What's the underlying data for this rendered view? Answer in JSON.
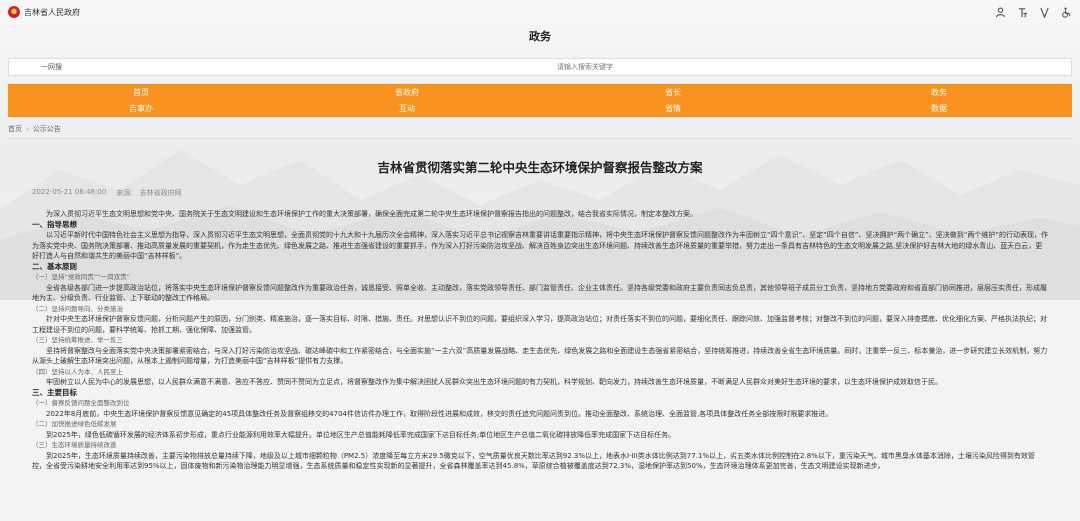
{
  "header": {
    "site_name": "吉林省人民政府"
  },
  "tools": [
    {
      "name": "person-icon"
    },
    {
      "name": "font-size-icon"
    },
    {
      "name": "accessibility-icon"
    },
    {
      "name": "wheelchair-icon"
    }
  ],
  "section": {
    "title": "政务"
  },
  "search": {
    "scope": "一网搜",
    "placeholder": "请输入搜索关键字"
  },
  "nav": {
    "items": [
      "首页",
      "省政府",
      "省长",
      "政务",
      "吉事办",
      "互动",
      "省情",
      "数据"
    ]
  },
  "breadcrumb": {
    "home": "首页",
    "current": "公示公告"
  },
  "article": {
    "title": "吉林省贯彻落实第二轮中央生态环境保护督察报告整改方案",
    "date": "2022-05-21 06:46:00",
    "source": "来源： 吉林省政府网",
    "intro": "为深入贯彻习近平生态文明思想和党中央、国务院关于生态文明建设和生态环境保护工作的重大决策部署，确保全面完成第二轮中央生态环境保护督察报告指出的问题整改，结合我省实际情况，制定本整改方案。",
    "s1_title": "一、指导思想",
    "s1_text": "以习近平新时代中国特色社会主义思想为指导，深入贯彻习近平生态文明思想，全面贯彻党的十九大和十九届历次全会精神，深入落实习近平总书记视察吉林重要讲话重要指示精神，将中央生态环境保护督察反馈问题整改作为丰固树立“四个意识”、坚定“四个自信”、坚决拥护“两个确立”、坚决做到“两个维护”的行动表现，作为落实党中央、国务院决策部署、推动高质量发展的重要契机，作为走生态优先、绿色发展之路、推进生态强省建设的重要抓手，作为深入打好污染防治攻坚战、解决百姓身边突出生态环境问题、持续改善生态环境质量的重要举措，努力走出一条具有吉林特色的生态文明发展之路,坚决保护好吉林大地的绿水青山、蓝天白云，更好打造人与自然和谐共生的美丽中国“吉林样板”。",
    "s2_title": "二、基本原则",
    "p1_title": "（一）坚持“党政同责”“一岗双责”",
    "p1_text": "全省各级各部门进一步提高政治站位，将落实中央生态环境保护督察反馈问题整改作为重要政治任务，诚恳接受、照单全收、主动整改，落实党政领导责任、部门监管责任、企业主体责任。坚持各级党委和政府主要负责同志负总责，其他领导班子成员分工负责，坚持地方党委政府和省直部门协同推进，层层压实责任，形成履地为主、分级负责、行业监管、上下联动的整改工作格局。",
    "p2_title": "（二）坚持问题导向、分类施治",
    "p2_text": "针对中央生态环境保护督察反馈问题，分析问题产生的原因，分门别类、精准施治，逐一落实目标、时限、措施、责任。对思想认识不到位的问题，要组织深入学习，提高政治站位；对责任落实不到位的问题，要细化责任、跟踪问效、加强监督考核；对整改不到位的问题，要深入排查摸底、优化细化方案、严格执法执纪；对工程建设不到位的问题，要科学统筹、抢抓工期、强化保障、加强监管。",
    "p3_title": "（三）坚持统筹推进、举一反三",
    "p3_text": "坚持将督察整改与全面落实党中央决策部署紧密结合，与深入打好污染防治攻坚战、碳达峰碳中和工作紧密结合，与全面实施“一主六双”高质量发展战略、走生态优先、绿色发展之路和全面建设生态强省紧密结合，坚持统筹推进，持续改善全省生态环境质量。同时，注重举一反三、标本兼治，进一步研究建立长效机制，努力从源头上破解生态环境突出问题，从根本上遏制问题增量，为打造美丽中国“吉林样板”提供有力支撑。",
    "p4_title": "（四）坚持以人为本、人民至上",
    "p4_text": "牢固树立以人民为中心的发展思想，以人民群众满意不满意、答应不答应、赞同不赞同为立足点，将督察整改作为集中解决困扰人民群众突出生态环境问题的有力契机，科学规划、靶向发力，持续改善生态环境质量，不断满足人民群众对美好生态环境的要求，以生态环境保护成效取信于民。",
    "s3_title": "三、主要目标",
    "g1_title": "（一）督察反馈问题全面整改到位",
    "g1_text": "2022年8月底前，中央生态环境保护督察反馈意见确定的45项具体整改任务及督察组移交的4704件信访件办理工作，取得阶段性进展和成效，移交的责任追究问题问责到位。推动全面整改、系统治理、全面监管,各项具体整改任务全部按限时限要求推进。",
    "g2_title": "（二）加快推进绿色低碳发展",
    "g2_text": "到2025年，绿色低碳循环发展的经济体系初步形成，重点行业能源利用效率大幅提升。单位地区生产总值能耗降低率完成国家下达目标任务;单位地区生产总值二氧化碳排放降低率完成国家下达目标任务。",
    "g3_title": "（三）生态环境质量持续改善",
    "g3_text": "到2025年，生态环境质量持续改善，主要污染物排放总量持续下降，地级及以上城市细颗粒物（PM2.5）浓度降至每立方米29.5微克以下，空气质量优良天数比率达到92.3%以上，地表水I-III类水体比例达到77.1%以上，劣五类水体比例控制在2.8%以下，重污染天气、城市黑臭水体基本消除，土壤污染风险得到有效管控，全省受污染耕地安全利用率达到95%以上，固体废物和新污染物治理能力明显增强，生态系统质量和稳定性实现新的显著提升，全省森林覆盖率达到45.8%，草原综合植被覆盖度达到72.3%，湿地保护率达到50%，生态环境治理体系更加完善，生态文明建设实现新进步。"
  }
}
